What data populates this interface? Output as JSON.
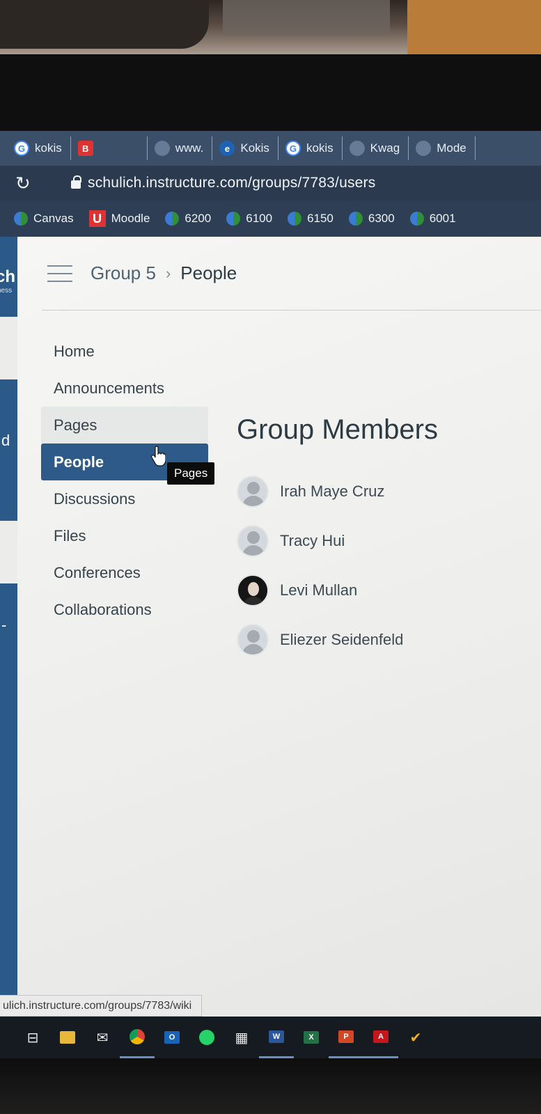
{
  "browser": {
    "tabs": [
      {
        "label": "kokis",
        "icon": "google-icon"
      },
      {
        "label": "B",
        "icon": "bookmark-icon"
      },
      {
        "label": "www.",
        "icon": "globe-icon"
      },
      {
        "label": "Kokis",
        "icon": "edge-icon"
      },
      {
        "label": "kokis",
        "icon": "google-icon"
      },
      {
        "label": "Kwag",
        "icon": "globe-icon"
      },
      {
        "label": "Mode",
        "icon": "globe-icon"
      }
    ],
    "url": "schulich.instructure.com/groups/7783/users",
    "bookmarks": [
      {
        "label": "Canvas",
        "icon": "canvas-icon"
      },
      {
        "label": "Moodle",
        "icon": "moodle-icon"
      },
      {
        "label": "6200",
        "icon": "site-icon"
      },
      {
        "label": "6100",
        "icon": "site-icon"
      },
      {
        "label": "6150",
        "icon": "site-icon"
      },
      {
        "label": "6300",
        "icon": "site-icon"
      },
      {
        "label": "6001",
        "icon": "site-icon"
      }
    ]
  },
  "global_nav": {
    "brand": "ch",
    "brand_sub": "ness",
    "glyph1": "d",
    "glyph2": "-"
  },
  "header": {
    "group": "Group 5",
    "separator": "›",
    "page": "People"
  },
  "course_nav": {
    "items": [
      "Home",
      "Announcements",
      "Pages",
      "People",
      "Discussions",
      "Files",
      "Conferences",
      "Collaborations"
    ],
    "active": "People",
    "hovered": "Pages",
    "tooltip": "Pages"
  },
  "content": {
    "title": "Group Members",
    "members": [
      {
        "name": "Irah Maye Cruz",
        "avatar": "default"
      },
      {
        "name": "Tracy Hui",
        "avatar": "default"
      },
      {
        "name": "Levi Mullan",
        "avatar": "photo"
      },
      {
        "name": "Eliezer Seidenfeld",
        "avatar": "default"
      }
    ]
  },
  "status_url": "ulich.instructure.com/groups/7783/wiki",
  "taskbar": {
    "icons": [
      "task-view-icon",
      "file-explorer-icon",
      "mail-icon",
      "chrome-icon",
      "outlook-icon",
      "whatsapp-icon",
      "calendar-icon",
      "word-icon",
      "excel-icon",
      "powerpoint-icon",
      "acrobat-icon",
      "check-icon"
    ]
  },
  "colors": {
    "nav_active": "#2d5a88",
    "tab_strip": "#3c4f68",
    "text": "#2d3b45"
  }
}
